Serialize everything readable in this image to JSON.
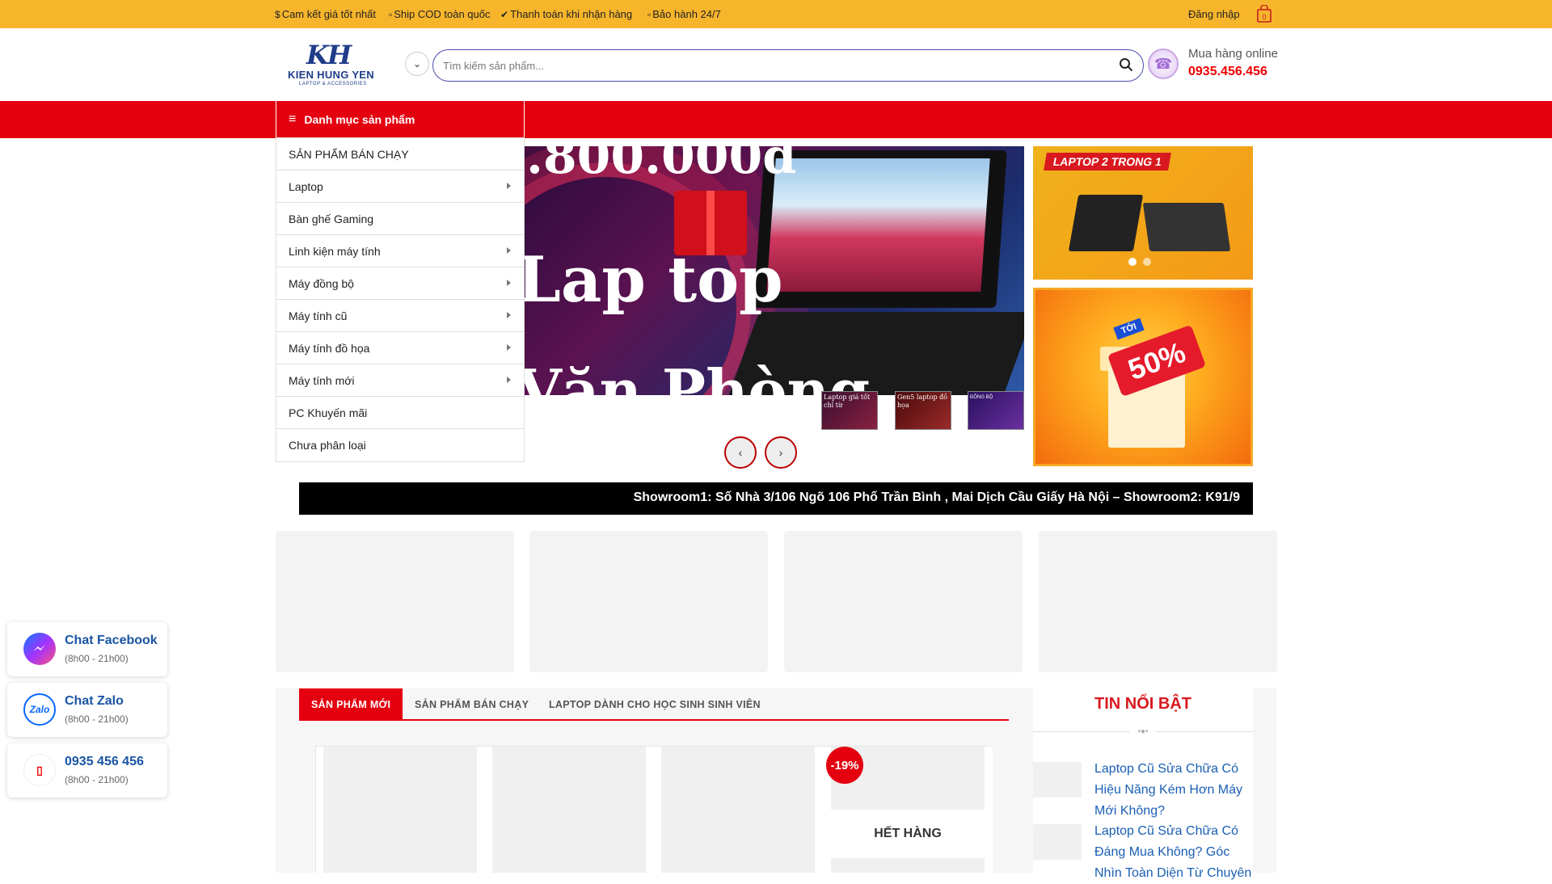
{
  "topbar": {
    "items": [
      {
        "icon": "$",
        "label": "Cam kết giá tốt nhất"
      },
      {
        "icon": "▫",
        "label": "Ship COD toàn quốc"
      },
      {
        "icon": "✔",
        "label": "Thanh toán khi nhận hàng"
      },
      {
        "icon": "▫",
        "label": "Bảo hành 24/7"
      }
    ],
    "login": "Đăng nhập",
    "cart_count": "0"
  },
  "logo": {
    "mark": "KH",
    "name": "KIEN HUNG YEN",
    "tagline": "LAPTOP & ACCESSORIES"
  },
  "search": {
    "placeholder": "Tìm kiếm sản phẩm..."
  },
  "hotline": {
    "label": "Mua hàng online",
    "number": "0935.456.456"
  },
  "category_menu": {
    "title": "Danh mục sản phẩm",
    "items": [
      {
        "label": "SẢN PHẨM BÁN CHẠY",
        "has_sub": false
      },
      {
        "label": "Laptop",
        "has_sub": true
      },
      {
        "label": "Bàn ghế Gaming",
        "has_sub": false
      },
      {
        "label": "Linh kiện máy tính",
        "has_sub": true
      },
      {
        "label": "Máy đồng bộ",
        "has_sub": true
      },
      {
        "label": "Máy tính cũ",
        "has_sub": true
      },
      {
        "label": "Máy tính đồ họa",
        "has_sub": true
      },
      {
        "label": "Máy tính mới",
        "has_sub": true
      },
      {
        "label": "PC Khuyến mãi",
        "has_sub": false
      },
      {
        "label": "Chưa phân loại",
        "has_sub": false
      }
    ]
  },
  "banner": {
    "line1": ".800.000đ",
    "line2": "Lap top",
    "line3": "Văn Phòng",
    "thumbs": [
      {
        "text": "Laptop giá tốt chỉ từ"
      },
      {
        "text": "Gen5 laptop đồ họa"
      },
      {
        "text": "ĐỒNG BỘ"
      }
    ]
  },
  "side_banner_1": {
    "tag": "LAPTOP 2 TRONG 1"
  },
  "side_banner_2": {
    "toi": "TỚI",
    "percent": "50%"
  },
  "marquee": {
    "text": "Showroom1: Số Nhà 3/106 Ngõ 106 Phố Trần Bình , Mai Dịch Cầu Giấy Hà Nội – Showroom2: K91/9"
  },
  "tabs": [
    {
      "label": "SẢN PHẨM MỚI",
      "active": true
    },
    {
      "label": "SẢN PHẨM BÁN CHẠY",
      "active": false
    },
    {
      "label": "LAPTOP DÀNH CHO HỌC SINH SINH VIÊN",
      "active": false
    }
  ],
  "products": {
    "sale_badge": "-19%",
    "out_of_stock": "HẾT HÀNG"
  },
  "news": {
    "title": "TIN NỔI BẬT",
    "items": [
      {
        "title": "Laptop Cũ Sửa Chữa Có Hiệu Năng Kém Hơn Máy Mới Không?"
      },
      {
        "title": "Laptop Cũ Sửa Chữa Có Đáng Mua Không? Góc Nhìn Toàn Diện Từ Chuyên"
      }
    ]
  },
  "chat": [
    {
      "title": "Chat Facebook",
      "hours": "(8h00 - 21h00)",
      "icon": "messenger-icon"
    },
    {
      "title": "Chat Zalo",
      "hours": "(8h00 - 21h00)",
      "icon": "zalo-icon"
    },
    {
      "title": "0935 456 456",
      "hours": "(8h00 - 21h00)",
      "icon": "phone-icon"
    }
  ],
  "colors": {
    "accent_red": "#e4000f",
    "topbar_yellow": "#f7b52c",
    "link_blue": "#1a5fb4"
  }
}
